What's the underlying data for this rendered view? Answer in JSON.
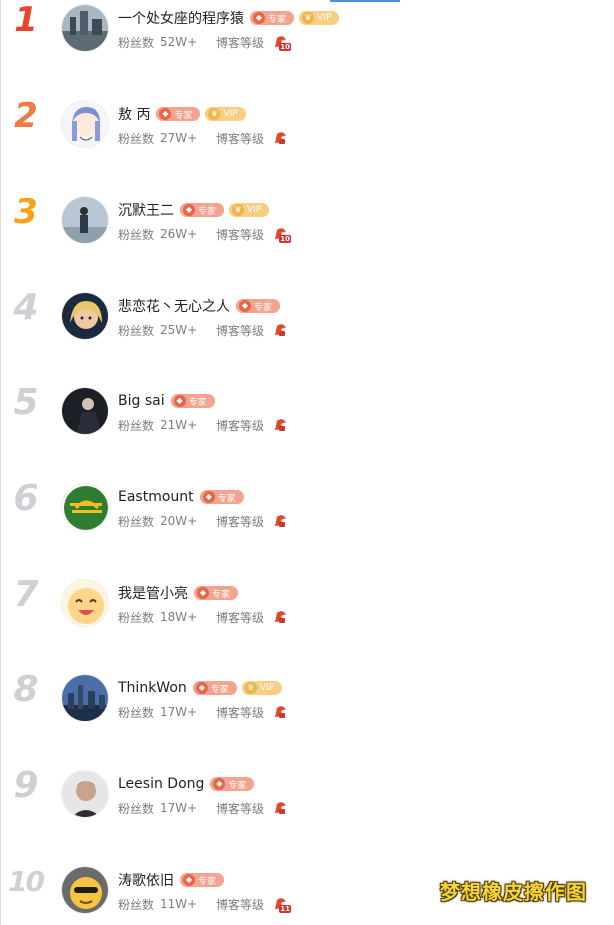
{
  "labels": {
    "fans": "粉丝数",
    "blog_level": "博客等级",
    "expert": "专家",
    "vip": "VIP"
  },
  "colors": {
    "expert_badge": "#f3a48f",
    "vip_badge": "#f6cf83",
    "rank_1": "#e8452b",
    "rank_2": "#f37a3f",
    "rank_3": "#f7a21b",
    "rank_other": "#cfd0d4",
    "level_icon": "#e8452b",
    "watermark": "#f5d33a"
  },
  "rankings": [
    {
      "rank": "1",
      "name": "一个处女座的程序猿",
      "fans": "52W+",
      "expert": true,
      "vip": true,
      "level": "10",
      "avatar": "city-landscape-avatar"
    },
    {
      "rank": "2",
      "name": "敖 丙",
      "fans": "27W+",
      "expert": true,
      "vip": true,
      "level": "",
      "avatar": "anime-girl-avatar"
    },
    {
      "rank": "3",
      "name": "沉默王二",
      "fans": "26W+",
      "expert": true,
      "vip": true,
      "level": "10",
      "avatar": "man-standing-avatar"
    },
    {
      "rank": "4",
      "name": "悲恋花丶无心之人",
      "fans": "25W+",
      "expert": true,
      "vip": false,
      "level": "",
      "avatar": "game-character-avatar"
    },
    {
      "rank": "5",
      "name": "Big sai",
      "fans": "21W+",
      "expert": true,
      "vip": false,
      "level": "",
      "avatar": "dark-figure-avatar"
    },
    {
      "rank": "6",
      "name": "Eastmount",
      "fans": "20W+",
      "expert": true,
      "vip": false,
      "level": "",
      "avatar": "green-logo-avatar"
    },
    {
      "rank": "7",
      "name": "我是管小亮",
      "fans": "18W+",
      "expert": true,
      "vip": false,
      "level": "",
      "avatar": "cartoon-face-avatar"
    },
    {
      "rank": "8",
      "name": "ThinkWon",
      "fans": "17W+",
      "expert": true,
      "vip": true,
      "level": "",
      "avatar": "city-night-avatar"
    },
    {
      "rank": "9",
      "name": "Leesin Dong",
      "fans": "17W+",
      "expert": true,
      "vip": false,
      "level": "",
      "avatar": "portrait-avatar"
    },
    {
      "rank": "10",
      "name": "涛歌依旧",
      "fans": "11W+",
      "expert": true,
      "vip": false,
      "level": "11",
      "avatar": "yellow-monkey-avatar"
    }
  ],
  "watermark": "梦想橡皮擦作图"
}
